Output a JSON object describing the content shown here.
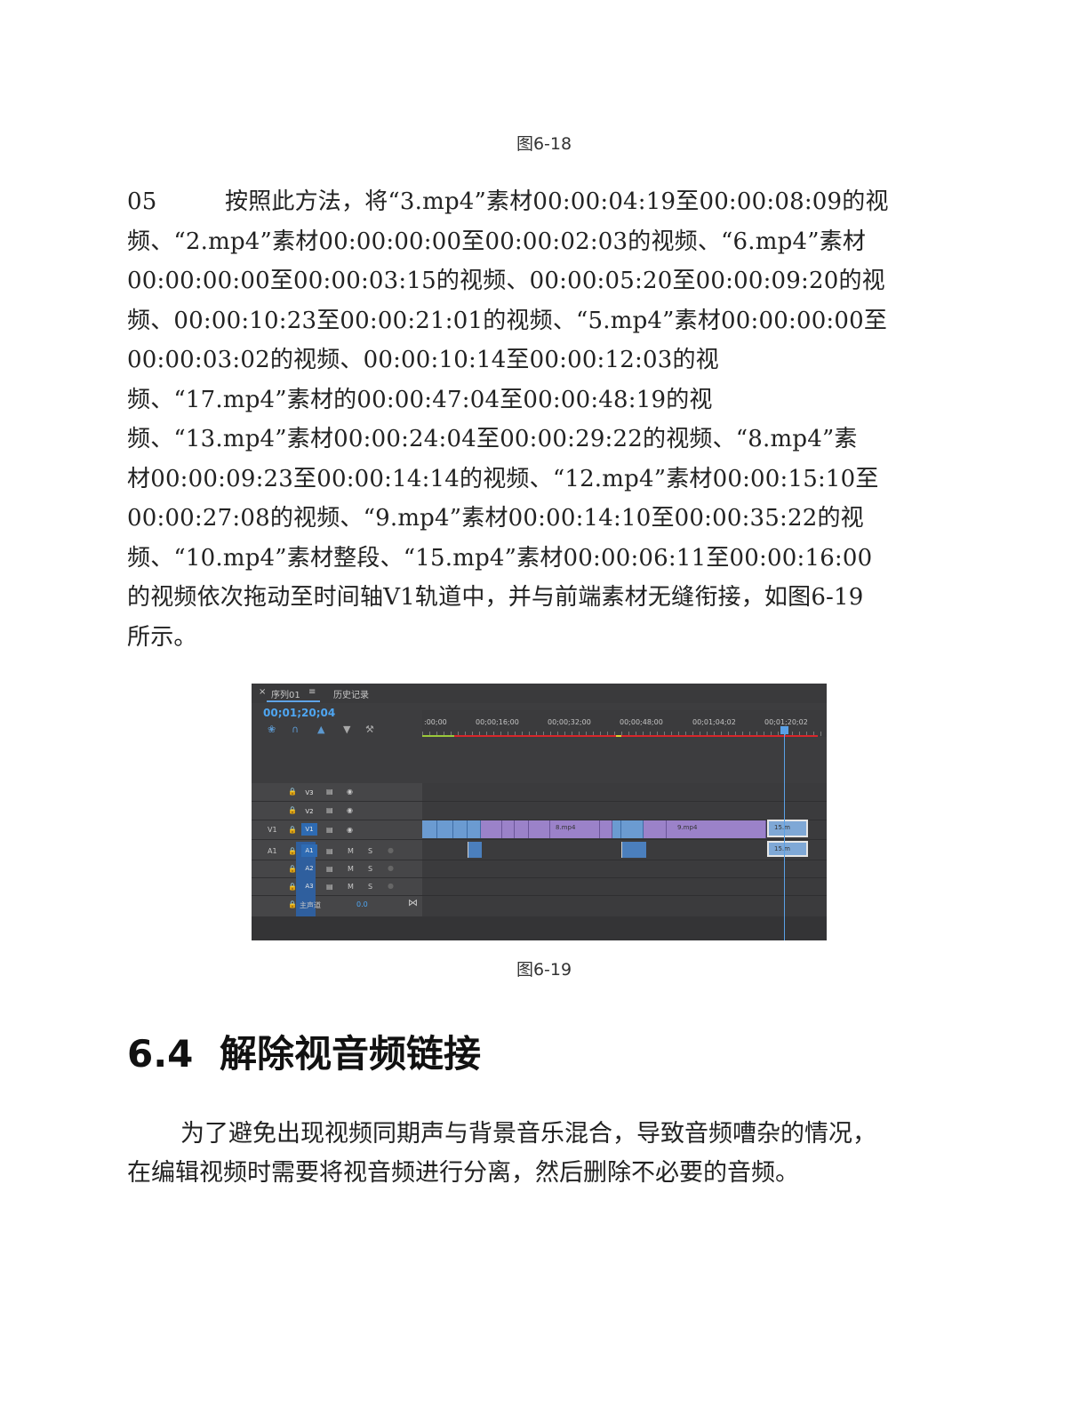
{
  "caption_top": "图6-18",
  "step": {
    "number": "05",
    "lines": [
      "按照此方法，将“3.mp4”素材00:00:04:19至00:00:08:09的视",
      "频、“2.mp4”素材00:00:00:00至00:00:02:03的视频、“6.mp4”素材",
      "00:00:00:00至00:00:03:15的视频、00:00:05:20至00:00:09:20的视",
      "频、00:00:10:23至00:00:21:01的视频、“5.mp4”素材00:00:00:00至",
      "00:00:03:02的视频、00:00:10:14至00:00:12:03的视",
      "频、“17.mp4”素材的00:00:47:04至00:00:48:19的视",
      "频、“13.mp4”素材00:00:24:04至00:00:29:22的视频、“8.mp4”素",
      "材00:00:09:23至00:00:14:14的视频、“12.mp4”素材00:00:15:10至",
      "00:00:27:08的视频、“9.mp4”素材00:00:14:10至00:00:35:22的视",
      "频、“10.mp4”素材整段、“15.mp4”素材00:00:06:11至00:00:16:00",
      "的视频依次拖动至时间轴V1轨道中，并与前端素材无缝衔接，如图6-19",
      "所示。"
    ]
  },
  "screenshot": {
    "tabs": {
      "close": "×",
      "sequence": "序列01",
      "menu": "≡",
      "history": "历史记录"
    },
    "timecode": "00;01;20;04",
    "ruler": [
      ":00;00",
      "00;00;16;00",
      "00;00;32;00",
      "00;00;48;00",
      "00;01;04;02",
      "00;01;20;02"
    ],
    "tracks": {
      "video": [
        "V3",
        "V2",
        "V1"
      ],
      "audio": [
        "A1",
        "A2",
        "A3"
      ],
      "source_v": "V1",
      "source_a": "A1",
      "mute": "M",
      "solo": "S",
      "master": "主声道",
      "master_value": "0.0"
    },
    "clips": {
      "c1": "8.mp4",
      "c2": "9.mp4",
      "c3": "15.m",
      "a_sel": "15.m"
    },
    "colors": {
      "accent": "#4ea6f2",
      "video_clip": "#9b82c9",
      "audio_clip": "#4b7fbd",
      "work_area": "#d8262b"
    }
  },
  "caption_fig": "图6-19",
  "section": {
    "number": "6.4",
    "title": "解除视音频链接"
  },
  "paragraph2": [
    "为了避免出现视频同期声与背景音乐混合，导致音频嘈杂的情况，",
    "在编辑视频时需要将视音频进行分离，然后删除不必要的音频。"
  ]
}
